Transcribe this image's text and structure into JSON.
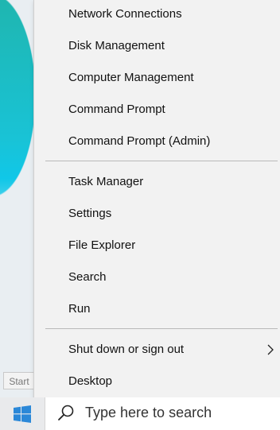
{
  "start_tooltip": "Start",
  "menu": {
    "group1": [
      "Network Connections",
      "Disk Management",
      "Computer Management",
      "Command Prompt",
      "Command Prompt (Admin)"
    ],
    "group2": [
      "Task Manager",
      "Settings",
      "File Explorer",
      "Search",
      "Run"
    ],
    "group3": {
      "shutdown": "Shut down or sign out",
      "desktop": "Desktop"
    }
  },
  "taskbar": {
    "search_placeholder": "Type here to search"
  },
  "colors": {
    "menu_bg": "#f2f2f2",
    "windows_logo": "#2b88d8",
    "taskbar_bg": "#e9eaec"
  },
  "icons": {
    "start": "windows-logo-icon",
    "search": "search-icon",
    "submenu": "chevron-right-icon"
  }
}
